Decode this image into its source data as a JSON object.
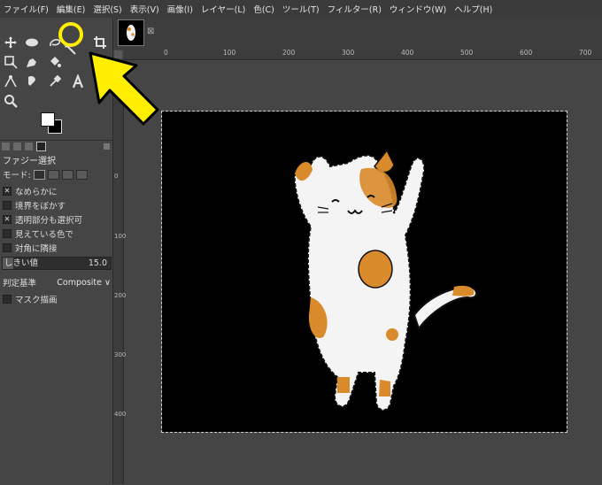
{
  "menu": [
    "ファイル(F)",
    "編集(E)",
    "選択(S)",
    "表示(V)",
    "画像(I)",
    "レイヤー(L)",
    "色(C)",
    "ツール(T)",
    "フィルター(R)",
    "ウィンドウ(W)",
    "ヘルプ(H)"
  ],
  "tool_options": {
    "title": "ファジー選択",
    "mode_label": "モード:",
    "checkboxes": [
      {
        "label": "なめらかに",
        "checked": true
      },
      {
        "label": "境界をぼかす",
        "checked": false
      },
      {
        "label": "透明部分も選択可",
        "checked": true
      },
      {
        "label": "見えている色で",
        "checked": false
      },
      {
        "label": "対角に隣接",
        "checked": false
      }
    ],
    "threshold_label": "しきい値",
    "threshold_value": "15.0",
    "criteria_label": "判定基準",
    "criteria_value": "Composite",
    "mask_label": "マスク描画"
  },
  "ruler": {
    "h_ticks": [
      "0",
      "100",
      "200",
      "300",
      "400",
      "500",
      "600",
      "700"
    ],
    "v_ticks": [
      "0",
      "100",
      "200",
      "300",
      "400"
    ]
  },
  "colors": {
    "foreground": "#ffffff",
    "background": "#000000",
    "annotation": "#ffee00"
  },
  "icons": [
    "move-icon",
    "ellipse-select-icon",
    "fuzzy-select-icon",
    "crop-icon",
    "scale-icon",
    "smudge-icon",
    "bucket-fill-icon",
    "text-icon",
    "path-icon",
    "clone-icon",
    "color-picker-icon",
    "zoom-icon"
  ]
}
